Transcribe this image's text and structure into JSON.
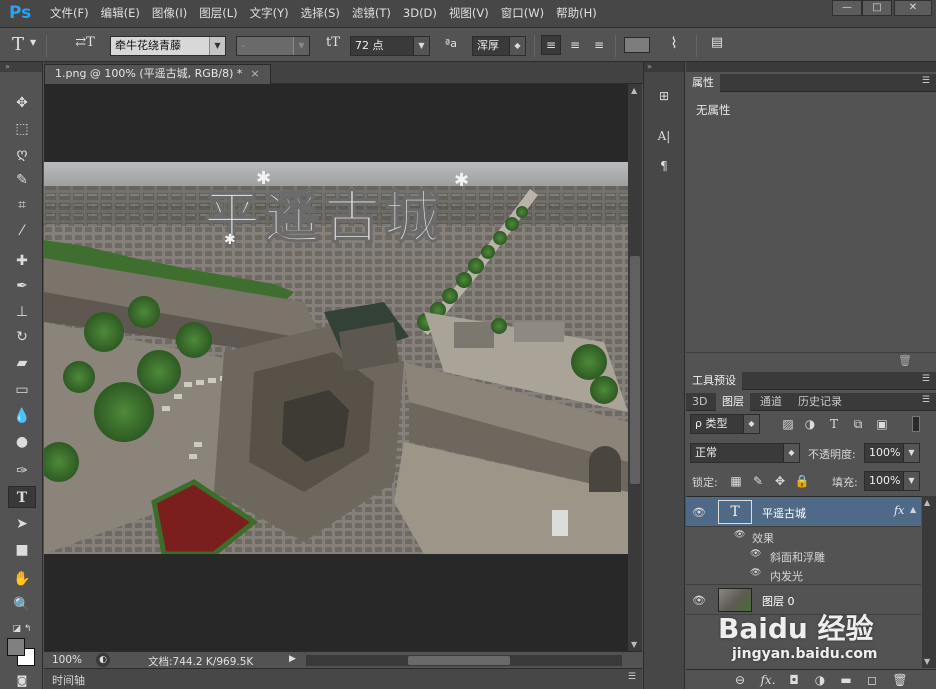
{
  "app": {
    "logo": "Ps"
  },
  "menu": [
    "文件(F)",
    "编辑(E)",
    "图像(I)",
    "图层(L)",
    "文字(Y)",
    "选择(S)",
    "滤镜(T)",
    "3D(D)",
    "视图(V)",
    "窗口(W)",
    "帮助(H)"
  ],
  "window_controls": [
    "—",
    "□",
    "✕"
  ],
  "options": {
    "tool_glyph": "T",
    "orient_glyph": "⇄T",
    "font_family": "牵牛花绕青藤",
    "font_style": "-",
    "size_glyph": "tT",
    "font_size": "72 点",
    "aa_glyph": "ªa",
    "anti_alias": "浑厚"
  },
  "document": {
    "tab_title": "1.png @ 100% (平遥古城, RGB/8) *",
    "tab_close": "×",
    "image_text": "平遥古城",
    "zoom": "100%",
    "doc_info": "文档:744.2 K/969.5K"
  },
  "timeline": {
    "label": "时间轴"
  },
  "properties": {
    "tab": "属性",
    "empty_text": "无属性"
  },
  "presets_panel": {
    "tab": "工具预设"
  },
  "layers_panel": {
    "tabs": [
      "3D",
      "图层",
      "通道",
      "历史记录"
    ],
    "filter_kind": "ρ 类型",
    "blend_mode": "正常",
    "opacity_label": "不透明度:",
    "opacity_value": "100%",
    "lock_label": "锁定:",
    "fill_label": "填充:",
    "fill_value": "100%",
    "layers": [
      {
        "name": "平遥古城",
        "type": "text",
        "fx": "fx",
        "thumb": "T"
      },
      {
        "name": "图层 0",
        "type": "image"
      }
    ],
    "effects_label": "效果",
    "effects": [
      "斜面和浮雕",
      "内发光"
    ]
  },
  "watermark": {
    "brand": "Baidu 经验",
    "url": "jingyan.baidu.com"
  }
}
